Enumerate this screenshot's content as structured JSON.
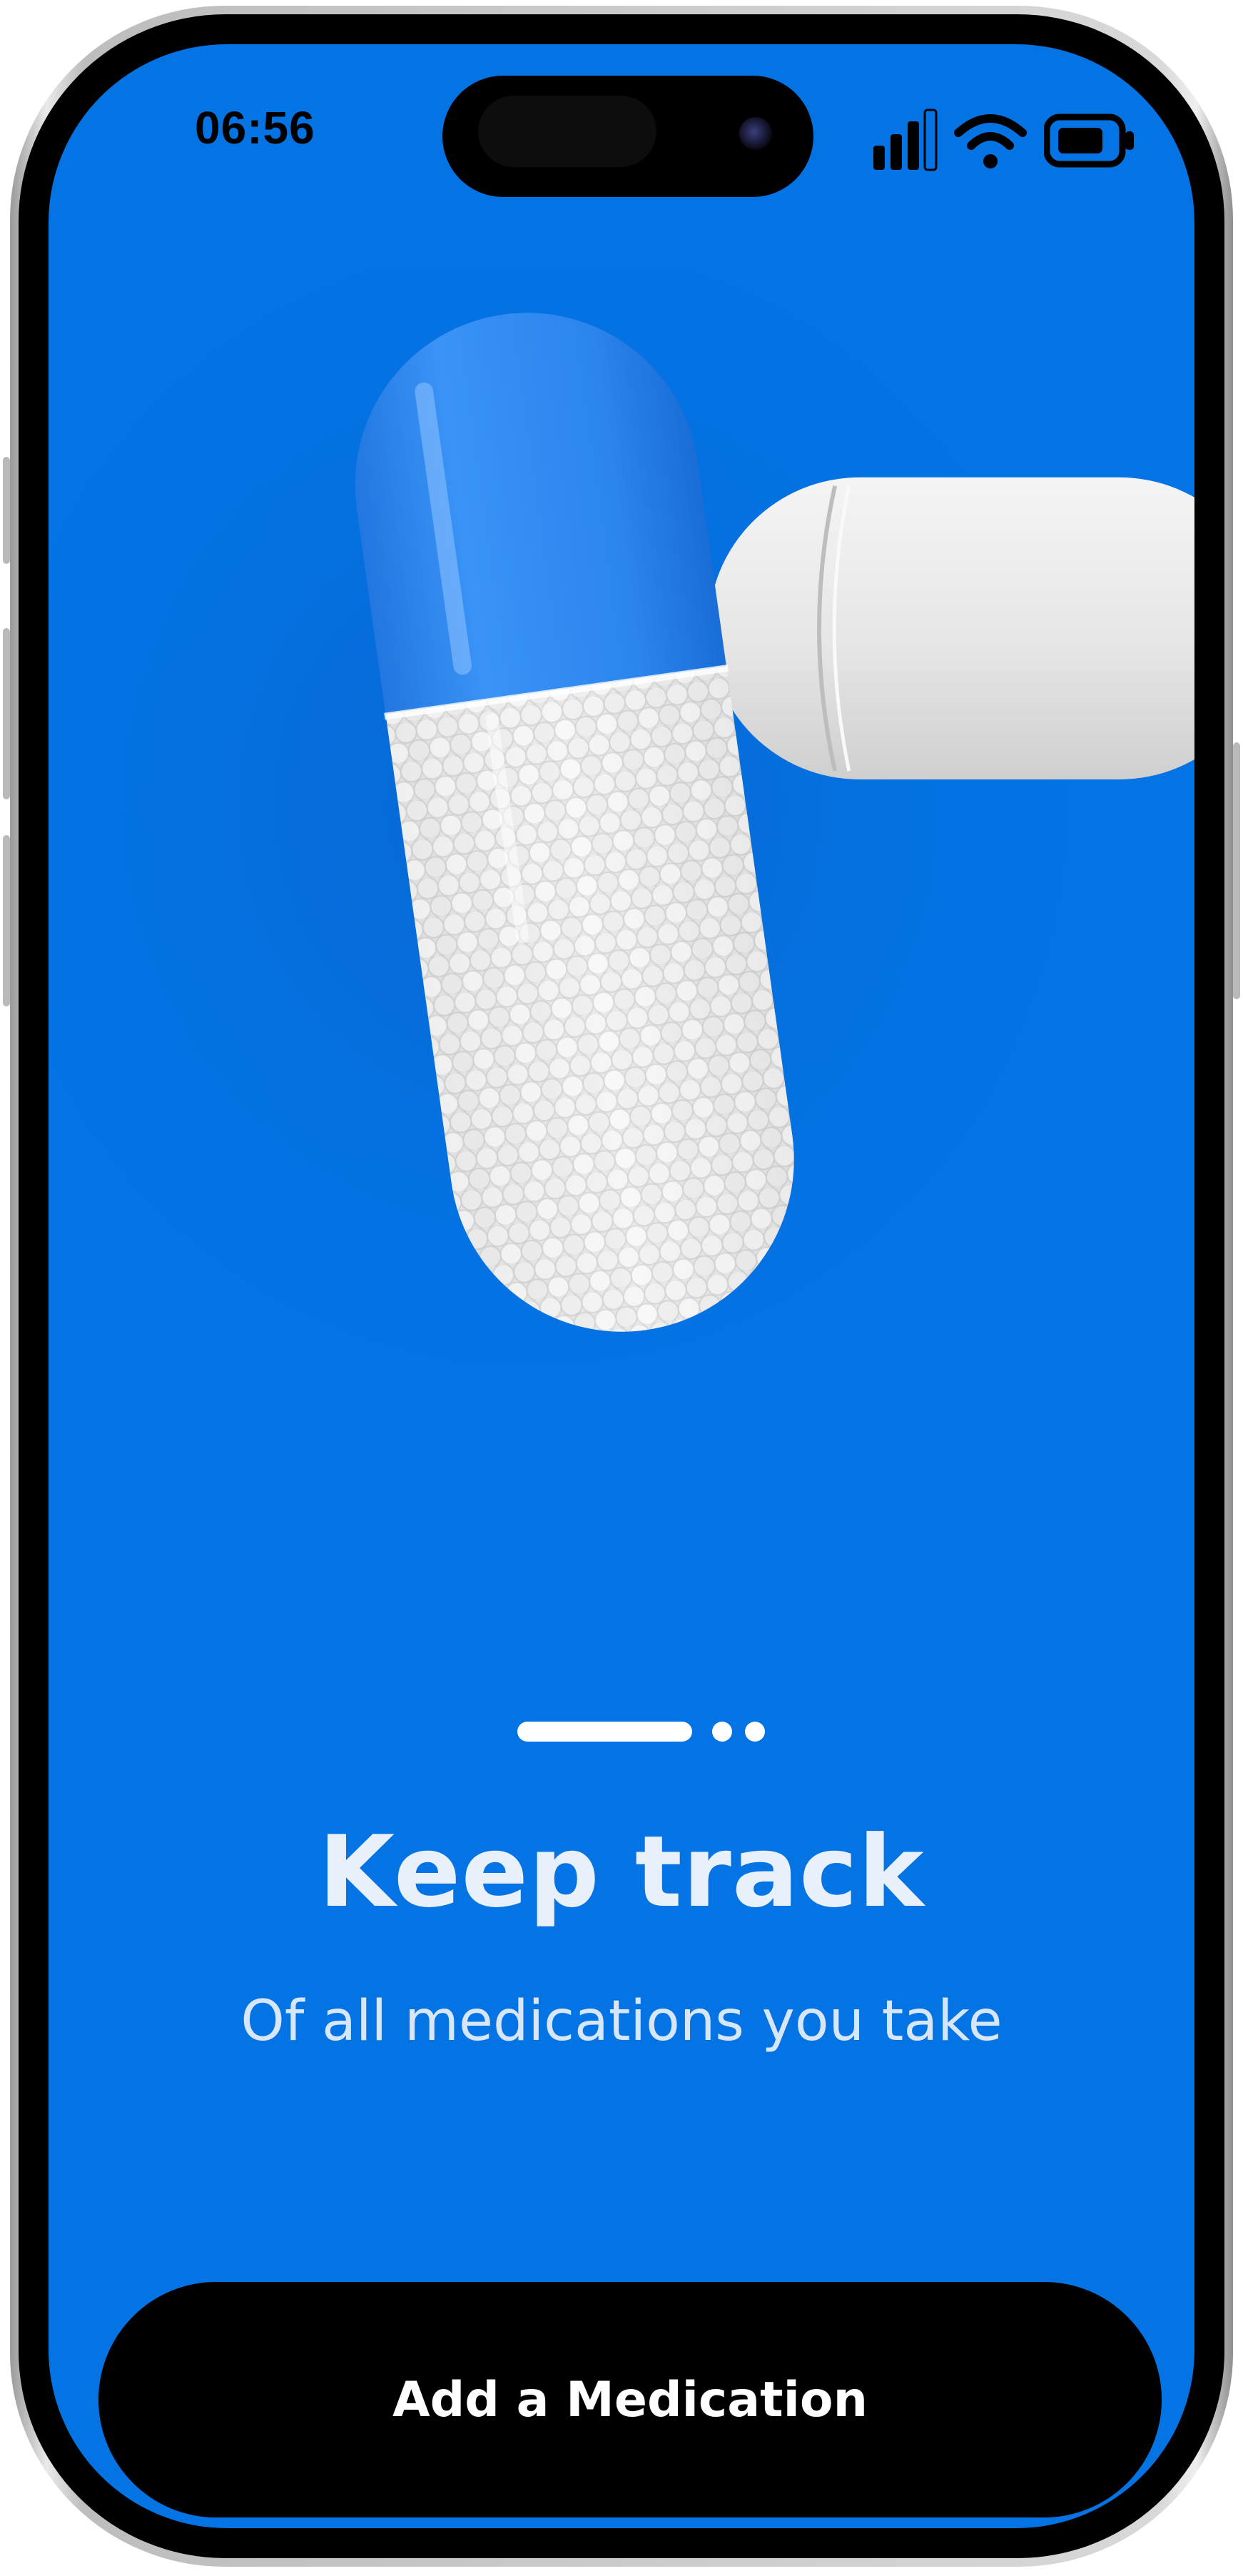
{
  "status_bar": {
    "time": "06:56",
    "icons": [
      "signal-icon",
      "wifi-icon",
      "battery-icon"
    ]
  },
  "onboarding": {
    "illustration": "capsule-pill-icon",
    "pagination": {
      "total_pages": 3,
      "current_page": 1
    },
    "title": "Keep track",
    "subtitle": "Of all medications you take",
    "primary_button_label": "Add a Medication"
  },
  "colors": {
    "background": "#0473e4",
    "capsule_blue": "#2f86ef",
    "capsule_white": "#ececec",
    "button": "#000000",
    "text": "#e8f0fb"
  }
}
